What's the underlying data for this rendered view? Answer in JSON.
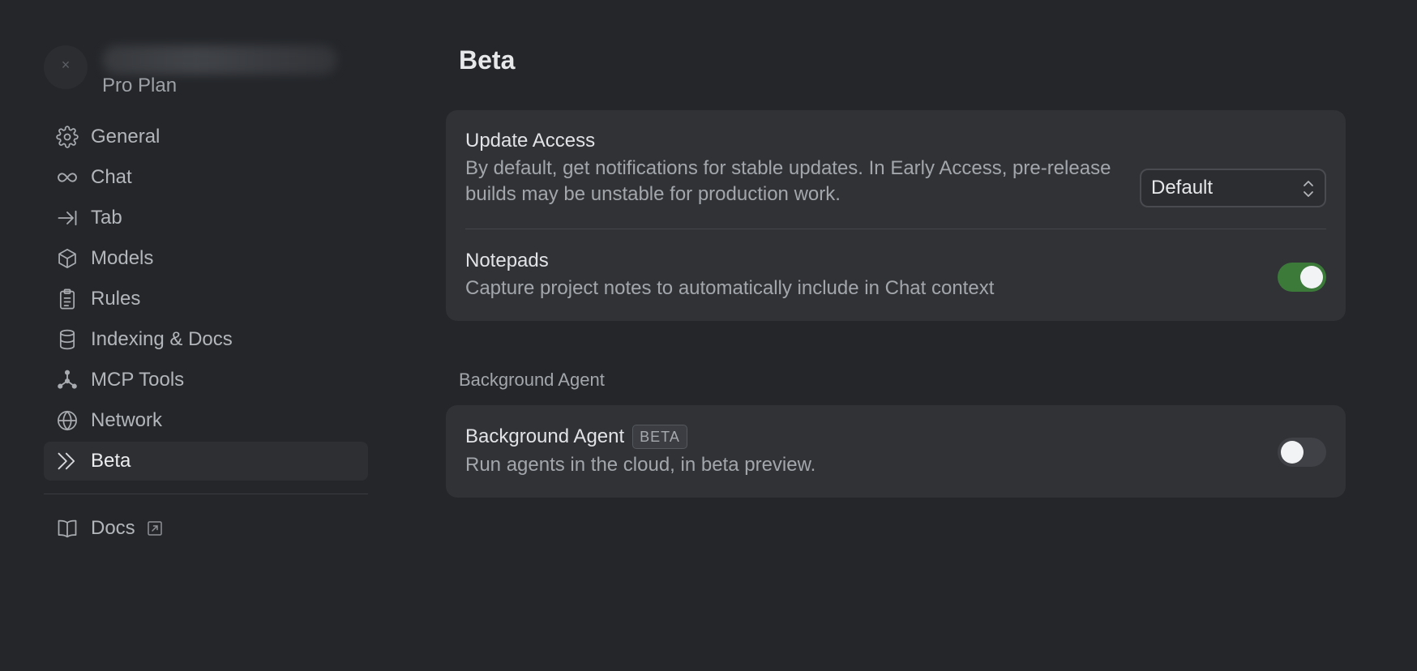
{
  "account": {
    "avatar_glyph": "×",
    "plan": "Pro Plan"
  },
  "sidebar": {
    "items": [
      {
        "label": "General",
        "icon": "gear-icon"
      },
      {
        "label": "Chat",
        "icon": "infinity-icon"
      },
      {
        "label": "Tab",
        "icon": "arrow-to-line-icon"
      },
      {
        "label": "Models",
        "icon": "cube-icon"
      },
      {
        "label": "Rules",
        "icon": "clipboard-icon"
      },
      {
        "label": "Indexing & Docs",
        "icon": "database-icon"
      },
      {
        "label": "MCP Tools",
        "icon": "nodes-icon"
      },
      {
        "label": "Network",
        "icon": "globe-icon"
      },
      {
        "label": "Beta",
        "icon": "double-chevron-icon",
        "active": true
      }
    ],
    "docs": {
      "label": "Docs",
      "icon": "book-icon",
      "external_icon": "external-link-icon"
    }
  },
  "main": {
    "title": "Beta",
    "update_access": {
      "title": "Update Access",
      "description": "By default, get notifications for stable updates. In Early Access, pre-release builds may be unstable for production work.",
      "select_value": "Default"
    },
    "notepads": {
      "title": "Notepads",
      "description": "Capture project notes to automatically include in Chat context",
      "enabled": true
    },
    "background_section": {
      "header": "Background Agent",
      "title": "Background Agent",
      "badge": "BETA",
      "description": "Run agents in the cloud, in beta preview.",
      "enabled": false
    }
  },
  "colors": {
    "background": "#24262a",
    "card": "#303236",
    "toggle_on": "#3c7a3a",
    "toggle_off": "#3f4146"
  }
}
